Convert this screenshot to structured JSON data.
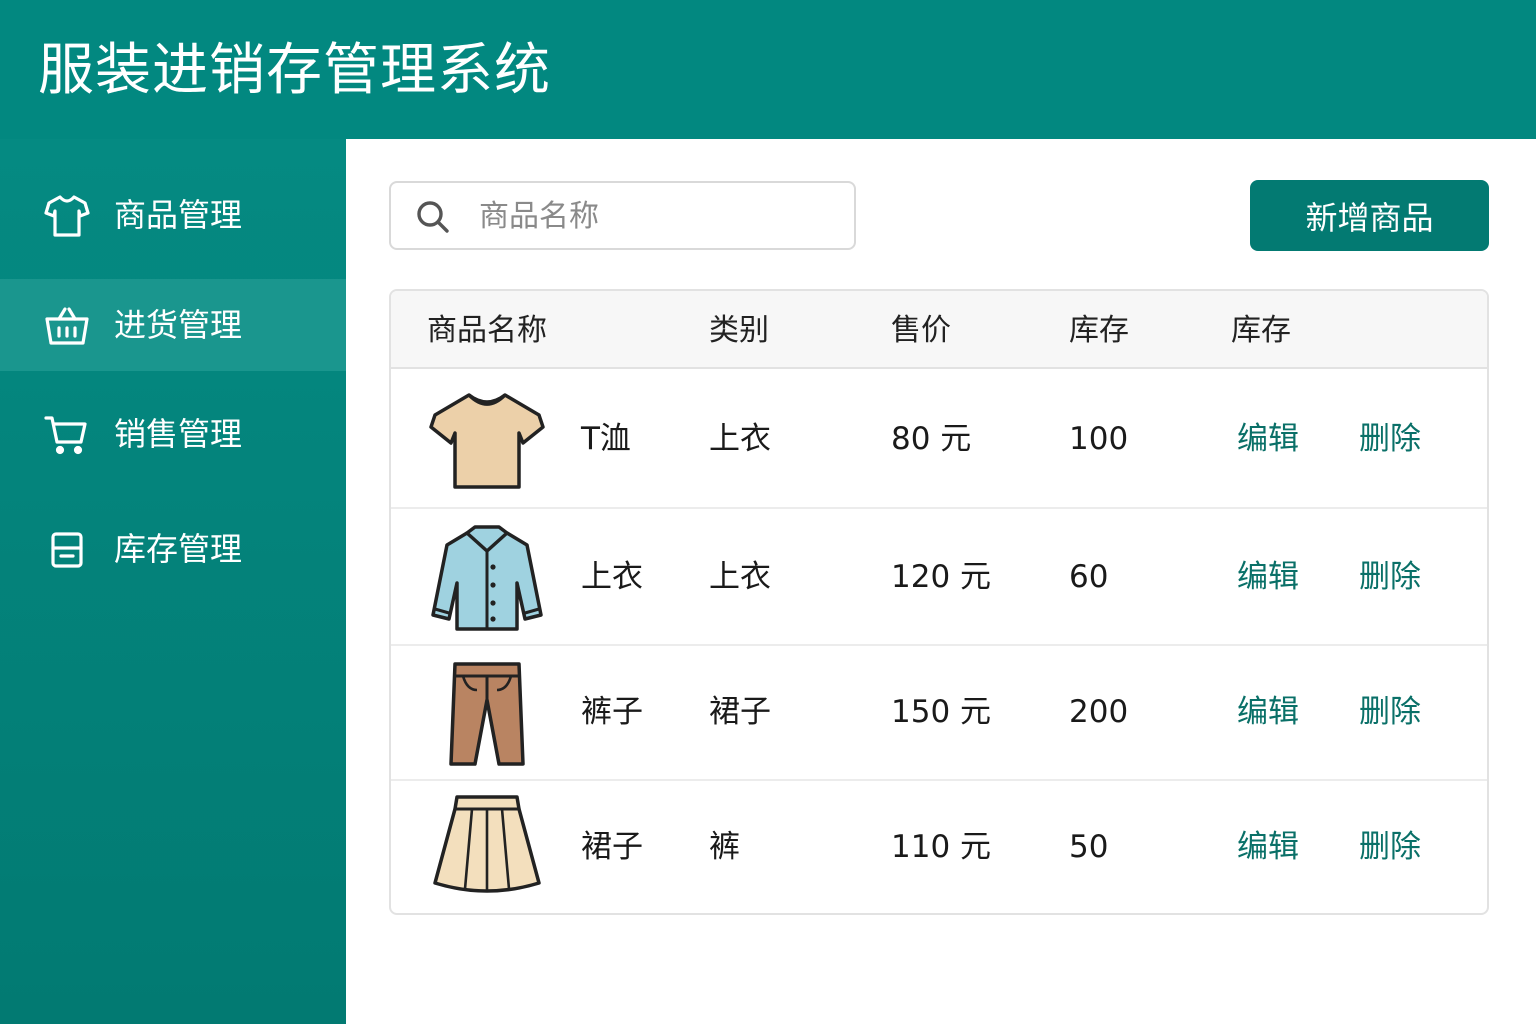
{
  "app": {
    "title": "服装进销存管理系统"
  },
  "sidebar": {
    "items": [
      {
        "label": "商品管理",
        "icon": "tshirt-icon",
        "active": false
      },
      {
        "label": "进货管理",
        "icon": "basket-icon",
        "active": true
      },
      {
        "label": "销售管理",
        "icon": "cart-icon",
        "active": false
      },
      {
        "label": "库存管理",
        "icon": "inventory-icon",
        "active": false
      }
    ]
  },
  "toolbar": {
    "search_placeholder": "商品名称",
    "add_label": "新增商品"
  },
  "table": {
    "headers": [
      "商品名称",
      "类别",
      "售价",
      "库存",
      "库存"
    ],
    "rows": [
      {
        "name": "T洫",
        "category": "上衣",
        "price": "80 元",
        "stock": "100",
        "edit": "编辑",
        "delete": "删除",
        "image": "tshirt-image"
      },
      {
        "name": "上衣",
        "category": "上衣",
        "price": "120 元",
        "stock": "60",
        "edit": "编辑",
        "delete": "删除",
        "image": "shirt-image"
      },
      {
        "name": "裤子",
        "category": "裙子",
        "price": "150 元",
        "stock": "200",
        "edit": "编辑",
        "delete": "删除",
        "image": "pants-image"
      },
      {
        "name": "裙子",
        "category": "裤",
        "price": "110 元",
        "stock": "50",
        "edit": "编辑",
        "delete": "删除",
        "image": "skirt-image"
      }
    ]
  },
  "colors": {
    "primary": "#028880",
    "sidebar_active": "#1a968e",
    "button": "#037a72",
    "link": "#0a7068"
  }
}
